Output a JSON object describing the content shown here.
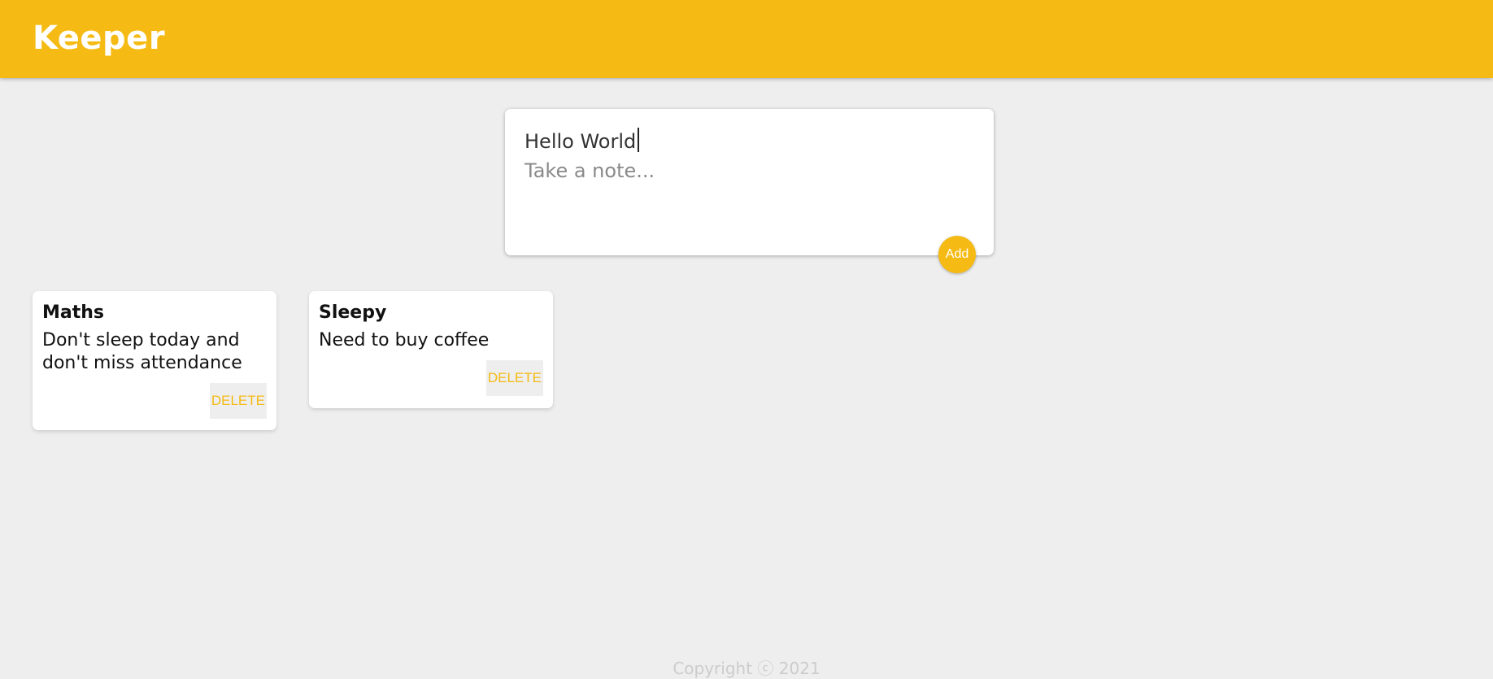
{
  "header": {
    "title": "Keeper"
  },
  "create_area": {
    "title_value": "Hello World",
    "content_placeholder": "Take a note...",
    "add_label": "Add"
  },
  "notes": [
    {
      "title": "Maths",
      "content": "Don't sleep today and don't miss attendance",
      "delete_label": "DELETE"
    },
    {
      "title": "Sleepy",
      "content": "Need to buy coffee",
      "delete_label": "DELETE"
    }
  ],
  "footer": {
    "text": "Copyright ⓒ 2021"
  },
  "colors": {
    "accent": "#f5ba13",
    "background": "#eeeeee"
  }
}
